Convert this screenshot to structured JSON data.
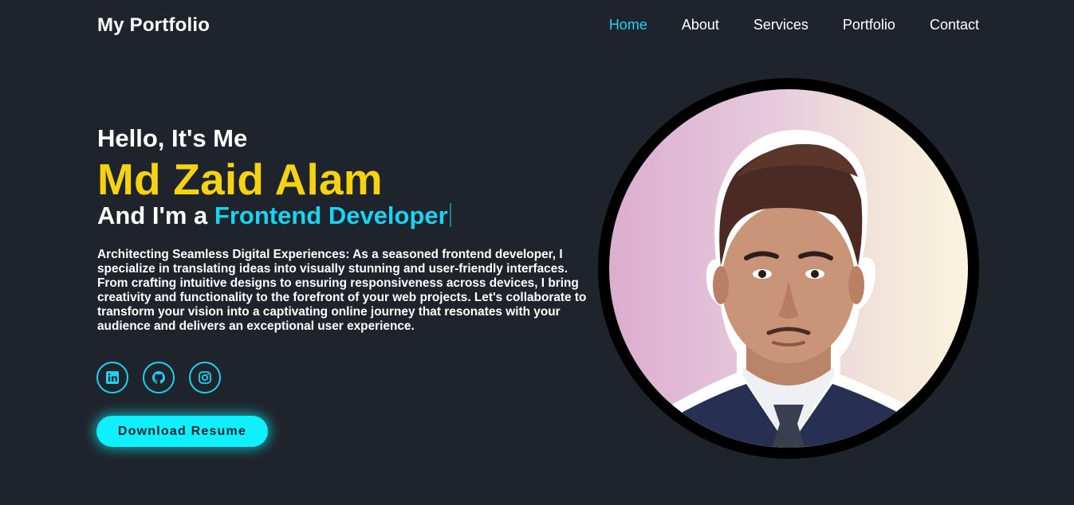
{
  "header": {
    "logo": "My Portfolio",
    "nav": [
      {
        "label": "Home",
        "active": true
      },
      {
        "label": "About"
      },
      {
        "label": "Services"
      },
      {
        "label": "Portfolio"
      },
      {
        "label": "Contact"
      }
    ]
  },
  "hero": {
    "greeting": "Hello, It's Me",
    "name": "Md Zaid Alam",
    "role_prefix": "And I'm a",
    "role_typed": "Frontend Developer",
    "description": "Architecting Seamless Digital Experiences: As a seasoned frontend developer, I specialize in translating ideas into visually stunning and user-friendly interfaces. From crafting intuitive designs to ensuring responsiveness across devices, I bring creativity and functionality to the forefront of your web projects. Let's collaborate to transform your vision into a captivating online journey that resonates with your audience and delivers an exceptional user experience.",
    "socials": [
      {
        "icon": "linkedin-icon"
      },
      {
        "icon": "github-icon"
      },
      {
        "icon": "instagram-icon"
      }
    ],
    "button_label": "Download Resume"
  },
  "colors": {
    "background": "#1f232c",
    "accent_cyan": "#18d4f2",
    "name_yellow": "#f6d215",
    "button_bg": "#0ff0fc"
  }
}
